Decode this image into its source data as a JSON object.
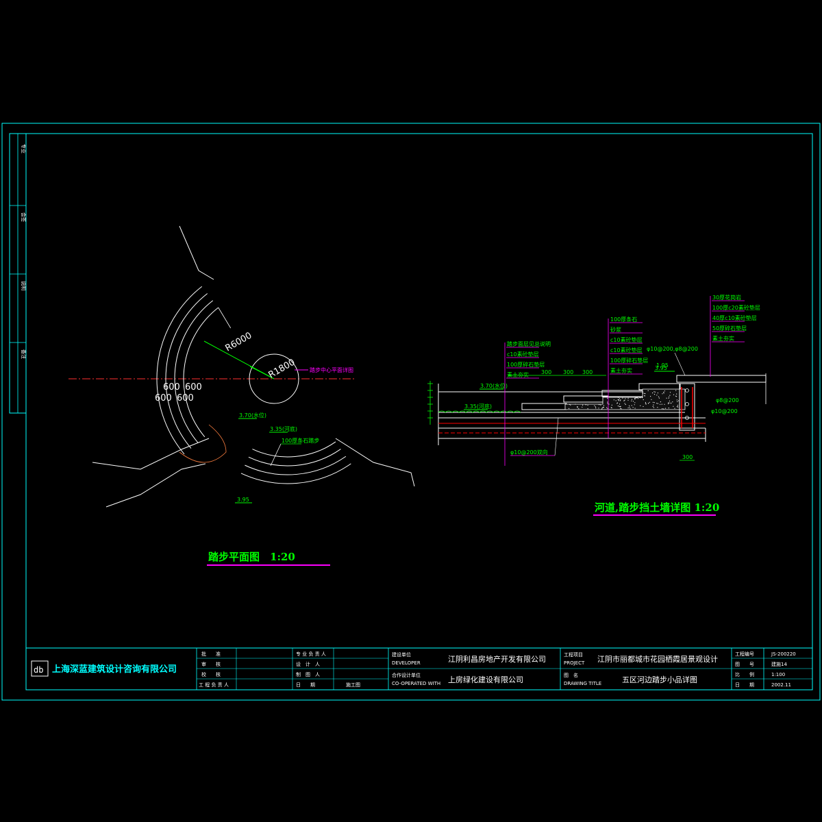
{
  "company": {
    "name": "上海深蓝建筑设计咨询有限公司",
    "logo_text": "db"
  },
  "left_strip": {
    "labels": [
      "专业",
      "会签",
      "说明",
      "备注"
    ]
  },
  "sign_block": {
    "roles_col1": [
      "批　　准",
      "审　　核",
      "校　　核",
      "工 程 负 责 人"
    ],
    "roles_col2": [
      "专 业 负 责 人",
      "设　计　人",
      "制　图　人",
      "日　　期"
    ],
    "stage": "施工图"
  },
  "developer": {
    "label_cn": "建设单位",
    "label_en": "DEVELOPER",
    "value": "江阴利昌房地产开发有限公司",
    "co_label_cn": "合作设计单位",
    "co_label_en": "CO-OPERATED WITH",
    "co_value": "上房绿化建设有限公司"
  },
  "project": {
    "label_cn": "工程项目",
    "label_en": "PROJECT",
    "value": "江阴市丽都城市花园栖霞居景观设计",
    "title_label_cn": "图　名",
    "title_label_en": "DRAWING TITLE",
    "title_value": "五区河边踏步小品详图"
  },
  "info": {
    "rows": [
      {
        "label": "工程编号",
        "value": "JS-200220"
      },
      {
        "label": "图　　号",
        "value": "建施14"
      },
      {
        "label": "比　　例",
        "value": "1:100"
      },
      {
        "label": "日　　期",
        "value": "2002.11"
      }
    ]
  },
  "plan": {
    "title": "踏步平面图　1:20",
    "r_outer": "R6000",
    "r_inner": "R1800",
    "dims_top": [
      "600",
      "600"
    ],
    "dims_bottom": [
      "600",
      "600"
    ],
    "levels": [
      "3.70(水位)",
      "3.35(河底)",
      "3.95"
    ],
    "note_pond": "100厚条石踏步",
    "note_center": "踏步中心平面详图"
  },
  "section": {
    "title": "河道,踏步挡土墙详图 1:20",
    "levels": [
      "3.70(水位)",
      "3.35(河底)",
      "3.95"
    ],
    "notes_left": [
      "踏步面层见总说明",
      "c10素砼垫层",
      "100厚碎石垫层",
      "素土夯实"
    ],
    "notes_mid": [
      "100厚条石",
      "砂浆",
      "c10素砼垫层",
      "c10素砼垫层",
      "100厚碎石垫层",
      "素土夯实"
    ],
    "notes_right": [
      "30厚花岗岩",
      "100厚c20素砼垫层",
      "40厚c10素砼垫层",
      "50厚碎石垫层",
      "素土夯实"
    ],
    "rebar_top": "φ10@200,φ8@200",
    "rebar_right": [
      "φ8@200",
      "φ10@200"
    ],
    "rebar_bottom": "φ10@200双向",
    "dim_bottom": "300",
    "dims_step": [
      "300",
      "300",
      "300"
    ],
    "dim_top": "1.95"
  },
  "colors": {
    "frame": "#00ffff",
    "title": "#00ff00",
    "underline": "#ff00ff",
    "line": "#ffffff",
    "axis": "#ff0000",
    "dim": "#00ff00",
    "hatch": "#ff00ff"
  }
}
